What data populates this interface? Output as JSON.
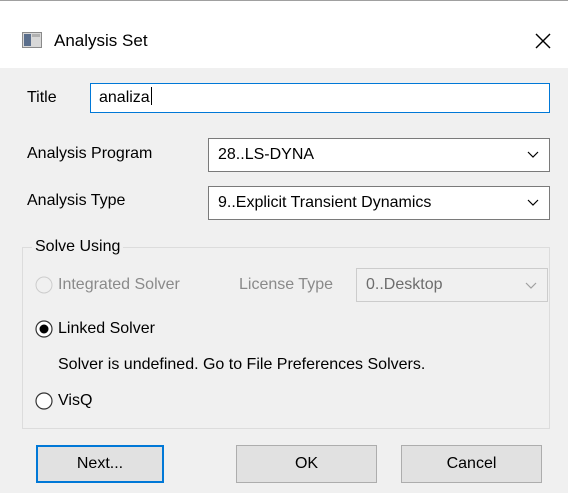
{
  "window": {
    "title": "Analysis Set"
  },
  "form": {
    "title_label": "Title",
    "title_value": "analiza",
    "program_label": "Analysis Program",
    "program_value": "28..LS-DYNA",
    "type_label": "Analysis Type",
    "type_value": "9..Explicit Transient Dynamics"
  },
  "solve": {
    "group_label": "Solve Using",
    "integrated_label": "Integrated Solver",
    "license_label": "License Type",
    "license_value": "0..Desktop",
    "linked_label": "Linked Solver",
    "linked_message": "Solver is undefined. Go to File Preferences Solvers.",
    "visq_label": "VisQ",
    "selected": "linked"
  },
  "buttons": {
    "next": "Next...",
    "ok": "OK",
    "cancel": "Cancel"
  },
  "colors": {
    "focus": "#0078d7",
    "background": "#f0f0f0"
  }
}
